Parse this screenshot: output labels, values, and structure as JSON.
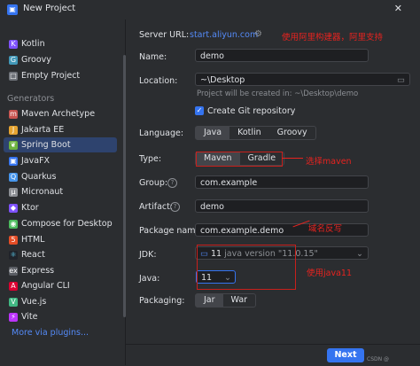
{
  "window": {
    "title": "New Project"
  },
  "sidebar": {
    "items_top": [
      {
        "label": "Kotlin",
        "color": "#7f52ff",
        "icon": "kotlin-icon"
      },
      {
        "label": "Groovy",
        "color": "#4298b8",
        "icon": "groovy-icon"
      },
      {
        "label": "Empty Project",
        "color": "#6f737a",
        "icon": "empty-project-icon"
      }
    ],
    "generators_header": "Generators",
    "items": [
      {
        "label": "Maven Archetype",
        "color": "#c75450",
        "icon": "maven-icon"
      },
      {
        "label": "Jakarta EE",
        "color": "#e5a331",
        "icon": "jakarta-icon"
      },
      {
        "label": "Spring Boot",
        "color": "#6db33f",
        "icon": "spring-icon"
      },
      {
        "label": "JavaFX",
        "color": "#3574f0",
        "icon": "javafx-icon"
      },
      {
        "label": "Quarkus",
        "color": "#4695eb",
        "icon": "quarkus-icon"
      },
      {
        "label": "Micronaut",
        "color": "#8c8f94",
        "icon": "micronaut-icon"
      },
      {
        "label": "Ktor",
        "color": "#7f52ff",
        "icon": "ktor-icon"
      },
      {
        "label": "Compose for Desktop",
        "color": "#4dbb5f",
        "icon": "compose-icon"
      },
      {
        "label": "HTML",
        "color": "#e44d26",
        "icon": "html-icon"
      },
      {
        "label": "React",
        "color": "#61dafb",
        "icon": "react-icon"
      },
      {
        "label": "Express",
        "color": "#8c8f94",
        "icon": "express-icon"
      },
      {
        "label": "Angular CLI",
        "color": "#dd0031",
        "icon": "angular-icon"
      },
      {
        "label": "Vue.js",
        "color": "#41b883",
        "icon": "vue-icon"
      },
      {
        "label": "Vite",
        "color": "#bd34fe",
        "icon": "vite-icon"
      }
    ],
    "selected": "Spring Boot",
    "more_plugins": "More via plugins..."
  },
  "form": {
    "server_url_label": "Server URL:",
    "server_url": "start.aliyun.com",
    "name_label": "Name:",
    "name": "demo",
    "location_label": "Location:",
    "location": "~\\Desktop",
    "location_hint": "Project will be created in: ~\\Desktop\\demo",
    "git_label": "Create Git repository",
    "language_label": "Language:",
    "languages": [
      "Java",
      "Kotlin",
      "Groovy"
    ],
    "type_label": "Type:",
    "types": [
      "Maven",
      "Gradle"
    ],
    "group_label": "Group:",
    "group": "com.example",
    "artifact_label": "Artifact:",
    "artifact": "demo",
    "package_label": "Package name:",
    "package": "com.example.demo",
    "jdk_label": "JDK:",
    "jdk_value": "11",
    "jdk_detail": "java version \"11.0.15\"",
    "java_label": "Java:",
    "java_value": "11",
    "packaging_label": "Packaging:",
    "packagings": [
      "Jar",
      "War"
    ]
  },
  "annotations": {
    "server": "使用阿里构建器，阿里支持",
    "maven": "选择maven",
    "package": "域名反写",
    "java": "使用java11"
  },
  "footer": {
    "next": "Next",
    "watermark": "CSDN @"
  },
  "colors": {
    "accent": "#3574f0",
    "annotation": "#e8231f"
  }
}
